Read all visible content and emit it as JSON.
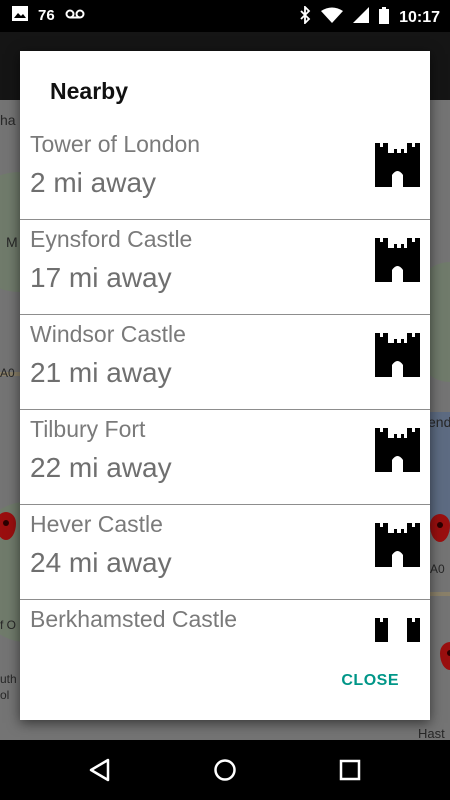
{
  "status_bar": {
    "time": "10:17",
    "notification_count": "76",
    "icons": [
      "image-icon",
      "voicemail-icon",
      "bluetooth-icon",
      "wifi-icon",
      "signal-icon",
      "battery-icon"
    ]
  },
  "dialog": {
    "title": "Nearby",
    "items": [
      {
        "name": "Tower of London",
        "distance": "2 mi away",
        "icon": "castle-icon"
      },
      {
        "name": "Eynsford Castle",
        "distance": "17 mi away",
        "icon": "castle-icon"
      },
      {
        "name": "Windsor Castle",
        "distance": "21 mi away",
        "icon": "castle-icon"
      },
      {
        "name": "Tilbury Fort",
        "distance": "22 mi away",
        "icon": "castle-icon"
      },
      {
        "name": "Hever Castle",
        "distance": "24 mi away",
        "icon": "castle-icon"
      },
      {
        "name": "Berkhamsted Castle",
        "distance": "",
        "icon": "castle-icon"
      }
    ],
    "close_label": "CLOSE",
    "accent_color": "#009688"
  },
  "map_labels": [
    "ha",
    "M",
    "A0",
    "end",
    "A0",
    "f O",
    "uth",
    "ol",
    "Hast"
  ],
  "nav_bar": {
    "icons": [
      "back-icon",
      "home-icon",
      "recents-icon"
    ]
  }
}
